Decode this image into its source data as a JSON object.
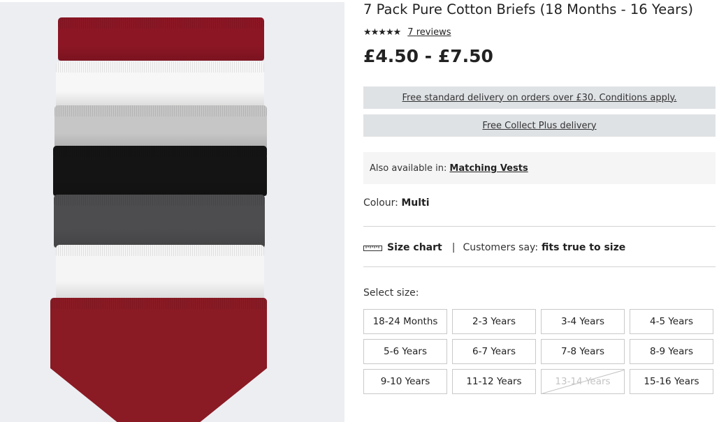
{
  "product": {
    "title": "7 Pack Pure Cotton Briefs (18 Months - 16 Years)",
    "rating_stars": "★★★★★",
    "reviews_count": "7",
    "reviews_label": "reviews",
    "price": "£4.50 - £7.50",
    "colors": {
      "burgundy": "#8c1624",
      "white": "#f7f7f7",
      "grey_light": "#c6c6c7",
      "black": "#141414",
      "grey_dark": "#4d4d4f",
      "image_background": "#edeef2"
    }
  },
  "delivery": {
    "standard": "Free standard delivery on orders over £30. Conditions apply.",
    "collect_plus": "Free Collect Plus delivery"
  },
  "also_available": {
    "label": "Also available in:",
    "link": "Matching Vests"
  },
  "colour": {
    "label": "Colour:",
    "value": "Multi"
  },
  "fit": {
    "size_chart_label": "Size chart",
    "separator": "|",
    "customers_say_label": "Customers say:",
    "customers_say_value": "fits true to size"
  },
  "sizes": {
    "label": "Select size:",
    "options": [
      {
        "label": "18-24 Months",
        "available": true
      },
      {
        "label": "2-3 Years",
        "available": true
      },
      {
        "label": "3-4 Years",
        "available": true
      },
      {
        "label": "4-5 Years",
        "available": true
      },
      {
        "label": "5-6 Years",
        "available": true
      },
      {
        "label": "6-7 Years",
        "available": true
      },
      {
        "label": "7-8 Years",
        "available": true
      },
      {
        "label": "8-9 Years",
        "available": true
      },
      {
        "label": "9-10 Years",
        "available": true
      },
      {
        "label": "11-12 Years",
        "available": true
      },
      {
        "label": "13-14 Years",
        "available": false
      },
      {
        "label": "15-16 Years",
        "available": true
      }
    ]
  }
}
